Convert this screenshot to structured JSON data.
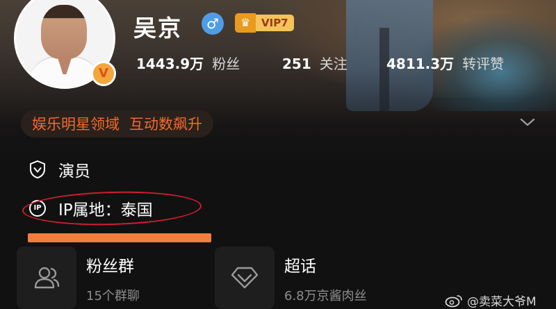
{
  "profile": {
    "name": "吴京",
    "gender_symbol": "♂",
    "vip_label": "VIP7",
    "verified_mark": "V"
  },
  "stats": [
    {
      "value": "1443.9万",
      "label": "粉丝"
    },
    {
      "value": "251",
      "label": "关注"
    },
    {
      "value": "4811.3万",
      "label": "转评赞"
    }
  ],
  "tags": {
    "items": [
      "娱乐明星领域",
      "互动数飙升"
    ]
  },
  "info": {
    "occupation": "演员",
    "ip_icon_text": "IP",
    "ip_location": "IP属地：泰国"
  },
  "cards": [
    {
      "title": "粉丝群",
      "subtitle": "15个群聊",
      "icon": "people-icon"
    },
    {
      "title": "超话",
      "subtitle": "6.8万京酱肉丝",
      "icon": "diamond-icon"
    }
  ],
  "watermark": "@卖菜大爷M",
  "colors": {
    "accent_orange": "#f26a2b",
    "annotation_red": "#d11e2e",
    "vip_gold": "#f4c35a",
    "gender_blue": "#4e9de6"
  }
}
